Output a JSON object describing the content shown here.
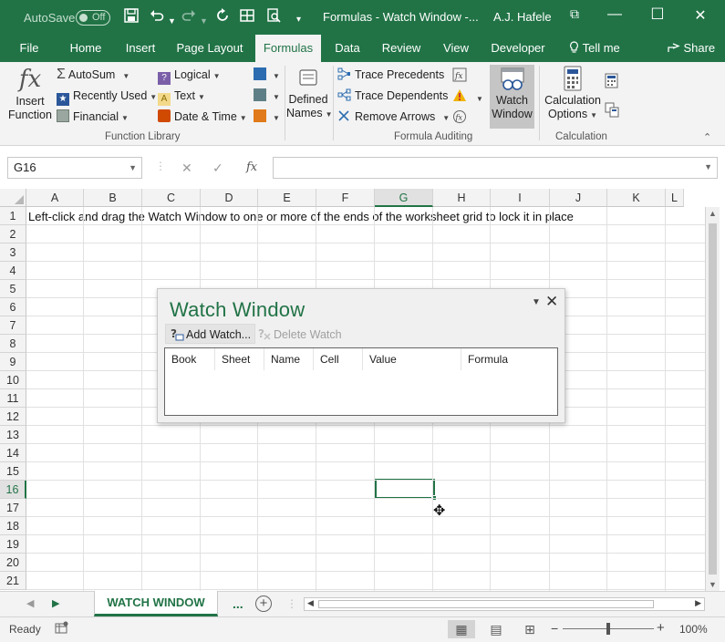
{
  "app": {
    "title": "Formulas - Watch Window  -...",
    "user": "A.J. Hafele",
    "autosave_label": "AutoSave",
    "autosave_state": "Off",
    "accent": "#217346"
  },
  "qat": {
    "save_icon": "save-icon",
    "undo_icon": "undo-icon",
    "redo_icon": "redo-icon",
    "refresh_icon": "refresh-icon",
    "form_icon": "form-icon",
    "print_preview_icon": "print-preview-icon",
    "customize_icon": "customize-qat-icon"
  },
  "window_controls": {
    "ribbon_display": "⧉",
    "minimize": "—",
    "maximize": "☐",
    "close": "✕"
  },
  "tabs": {
    "file": "File",
    "home": "Home",
    "insert": "Insert",
    "page_layout": "Page Layout",
    "formulas": "Formulas",
    "data": "Data",
    "review": "Review",
    "view": "View",
    "developer": "Developer",
    "tell_me": "Tell me",
    "share": "Share"
  },
  "ribbon": {
    "insert_function": {
      "line1": "Insert",
      "line2": "Function",
      "glyph": "fx"
    },
    "function_library": {
      "label": "Function Library",
      "autosum": "AutoSum",
      "recently_used": "Recently Used",
      "financial": "Financial",
      "logical": "Logical",
      "text": "Text",
      "date_time": "Date & Time"
    },
    "defined_names": {
      "line1": "Defined",
      "line2": "Names"
    },
    "formula_auditing": {
      "label": "Formula Auditing",
      "trace_precedents": "Trace Precedents",
      "trace_dependents": "Trace Dependents",
      "remove_arrows": "Remove Arrows",
      "watch_window_line1": "Watch",
      "watch_window_line2": "Window"
    },
    "calculation": {
      "label": "Calculation",
      "options_line1": "Calculation",
      "options_line2": "Options"
    }
  },
  "formula_bar": {
    "name_box": "G16",
    "cancel": "✕",
    "enter": "✓",
    "fx": "fx",
    "content": ""
  },
  "grid": {
    "columns": [
      "A",
      "B",
      "C",
      "D",
      "E",
      "F",
      "G",
      "H",
      "I",
      "J",
      "K",
      "L"
    ],
    "rows": [
      "1",
      "2",
      "3",
      "4",
      "5",
      "6",
      "7",
      "8",
      "9",
      "10",
      "11",
      "12",
      "13",
      "14",
      "15",
      "16",
      "17",
      "18",
      "19",
      "20",
      "21"
    ],
    "selected_column": "G",
    "selected_row": "16",
    "a1_text": "Left-click and drag the Watch Window to one or more of the ends of the worksheet grid to lock it in place"
  },
  "watch_window": {
    "title": "Watch Window",
    "add_watch": "Add Watch...",
    "delete_watch": "Delete Watch",
    "columns": [
      "Book",
      "Sheet",
      "Name",
      "Cell",
      "Value",
      "Formula"
    ]
  },
  "sheet_tabs": {
    "active": "WATCH WINDOW",
    "more": "...",
    "add": "+"
  },
  "status": {
    "ready": "Ready",
    "zoom": "100%",
    "zoom_level_percent": 100,
    "zoom_minus": "−",
    "zoom_plus": "+"
  }
}
